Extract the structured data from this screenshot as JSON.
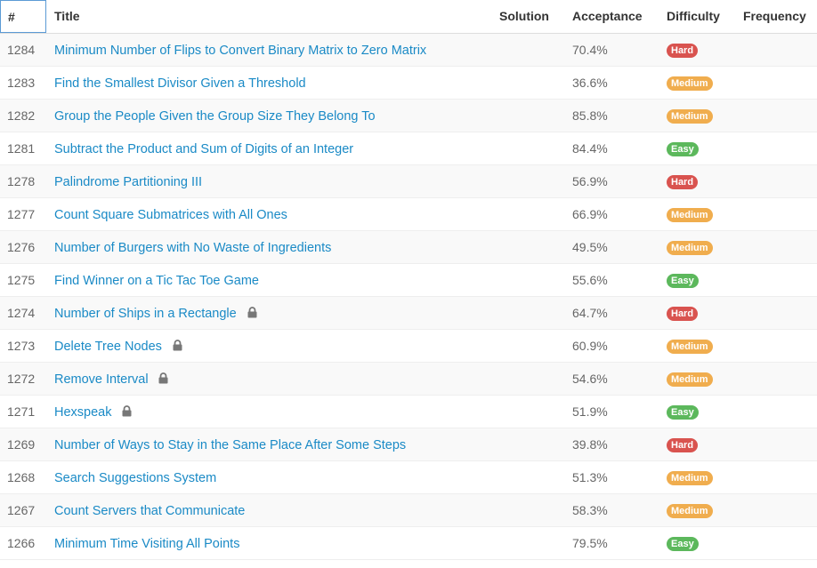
{
  "header": {
    "num": "#",
    "title": "Title",
    "solution": "Solution",
    "acceptance": "Acceptance",
    "difficulty": "Difficulty",
    "frequency": "Frequency"
  },
  "colors": {
    "Easy": "#5cb85c",
    "Medium": "#f0ad4e",
    "Hard": "#d9534f",
    "link": "#1a8ac6"
  },
  "rows": [
    {
      "id": "1284",
      "title": "Minimum Number of Flips to Convert Binary Matrix to Zero Matrix",
      "locked": false,
      "acceptance": "70.4%",
      "difficulty": "Hard"
    },
    {
      "id": "1283",
      "title": "Find the Smallest Divisor Given a Threshold",
      "locked": false,
      "acceptance": "36.6%",
      "difficulty": "Medium"
    },
    {
      "id": "1282",
      "title": "Group the People Given the Group Size They Belong To",
      "locked": false,
      "acceptance": "85.8%",
      "difficulty": "Medium"
    },
    {
      "id": "1281",
      "title": "Subtract the Product and Sum of Digits of an Integer",
      "locked": false,
      "acceptance": "84.4%",
      "difficulty": "Easy"
    },
    {
      "id": "1278",
      "title": "Palindrome Partitioning III",
      "locked": false,
      "acceptance": "56.9%",
      "difficulty": "Hard"
    },
    {
      "id": "1277",
      "title": "Count Square Submatrices with All Ones",
      "locked": false,
      "acceptance": "66.9%",
      "difficulty": "Medium"
    },
    {
      "id": "1276",
      "title": "Number of Burgers with No Waste of Ingredients",
      "locked": false,
      "acceptance": "49.5%",
      "difficulty": "Medium"
    },
    {
      "id": "1275",
      "title": "Find Winner on a Tic Tac Toe Game",
      "locked": false,
      "acceptance": "55.6%",
      "difficulty": "Easy"
    },
    {
      "id": "1274",
      "title": "Number of Ships in a Rectangle",
      "locked": true,
      "acceptance": "64.7%",
      "difficulty": "Hard"
    },
    {
      "id": "1273",
      "title": "Delete Tree Nodes",
      "locked": true,
      "acceptance": "60.9%",
      "difficulty": "Medium"
    },
    {
      "id": "1272",
      "title": "Remove Interval",
      "locked": true,
      "acceptance": "54.6%",
      "difficulty": "Medium"
    },
    {
      "id": "1271",
      "title": "Hexspeak",
      "locked": true,
      "acceptance": "51.9%",
      "difficulty": "Easy"
    },
    {
      "id": "1269",
      "title": "Number of Ways to Stay in the Same Place After Some Steps",
      "locked": false,
      "acceptance": "39.8%",
      "difficulty": "Hard"
    },
    {
      "id": "1268",
      "title": "Search Suggestions System",
      "locked": false,
      "acceptance": "51.3%",
      "difficulty": "Medium"
    },
    {
      "id": "1267",
      "title": "Count Servers that Communicate",
      "locked": false,
      "acceptance": "58.3%",
      "difficulty": "Medium"
    },
    {
      "id": "1266",
      "title": "Minimum Time Visiting All Points",
      "locked": false,
      "acceptance": "79.5%",
      "difficulty": "Easy"
    }
  ]
}
